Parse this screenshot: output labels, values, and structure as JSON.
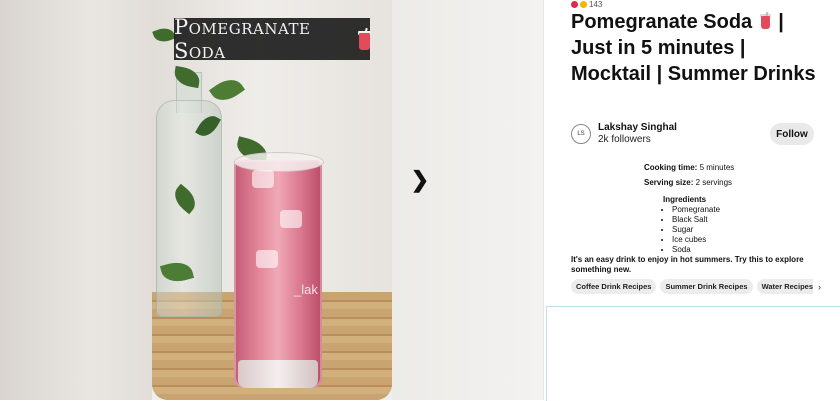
{
  "media": {
    "overlay_title": "Pomegranate Soda",
    "watermark": "_lak",
    "next_icon": "chevron-right-icon"
  },
  "pin": {
    "reaction_count": "143",
    "title_part1": "Pomegranate Soda",
    "title_part2": "| Just in 5 minutes | Mocktail | Summer Drinks"
  },
  "author": {
    "avatar_text": "LS",
    "name": "Lakshay Singhal",
    "followers": "2k followers",
    "follow_label": "Follow"
  },
  "recipe": {
    "cooking_label": "Cooking time:",
    "cooking_value": "5 minutes",
    "serving_label": "Serving size:",
    "serving_value": "2 servings",
    "ingredients_label": "Ingredients",
    "ingredients": [
      "Pomegranate",
      "Black Salt",
      "Sugar",
      "Ice cubes",
      "Soda"
    ],
    "description": "It's an easy drink to enjoy in hot summers. Try this to explore something new."
  },
  "tags": [
    "Coffee Drink Recipes",
    "Summer Drink Recipes",
    "Water Recipes"
  ],
  "colors": {
    "accent_red": "#e24b5a",
    "follow_bg": "#e9e9e9"
  }
}
